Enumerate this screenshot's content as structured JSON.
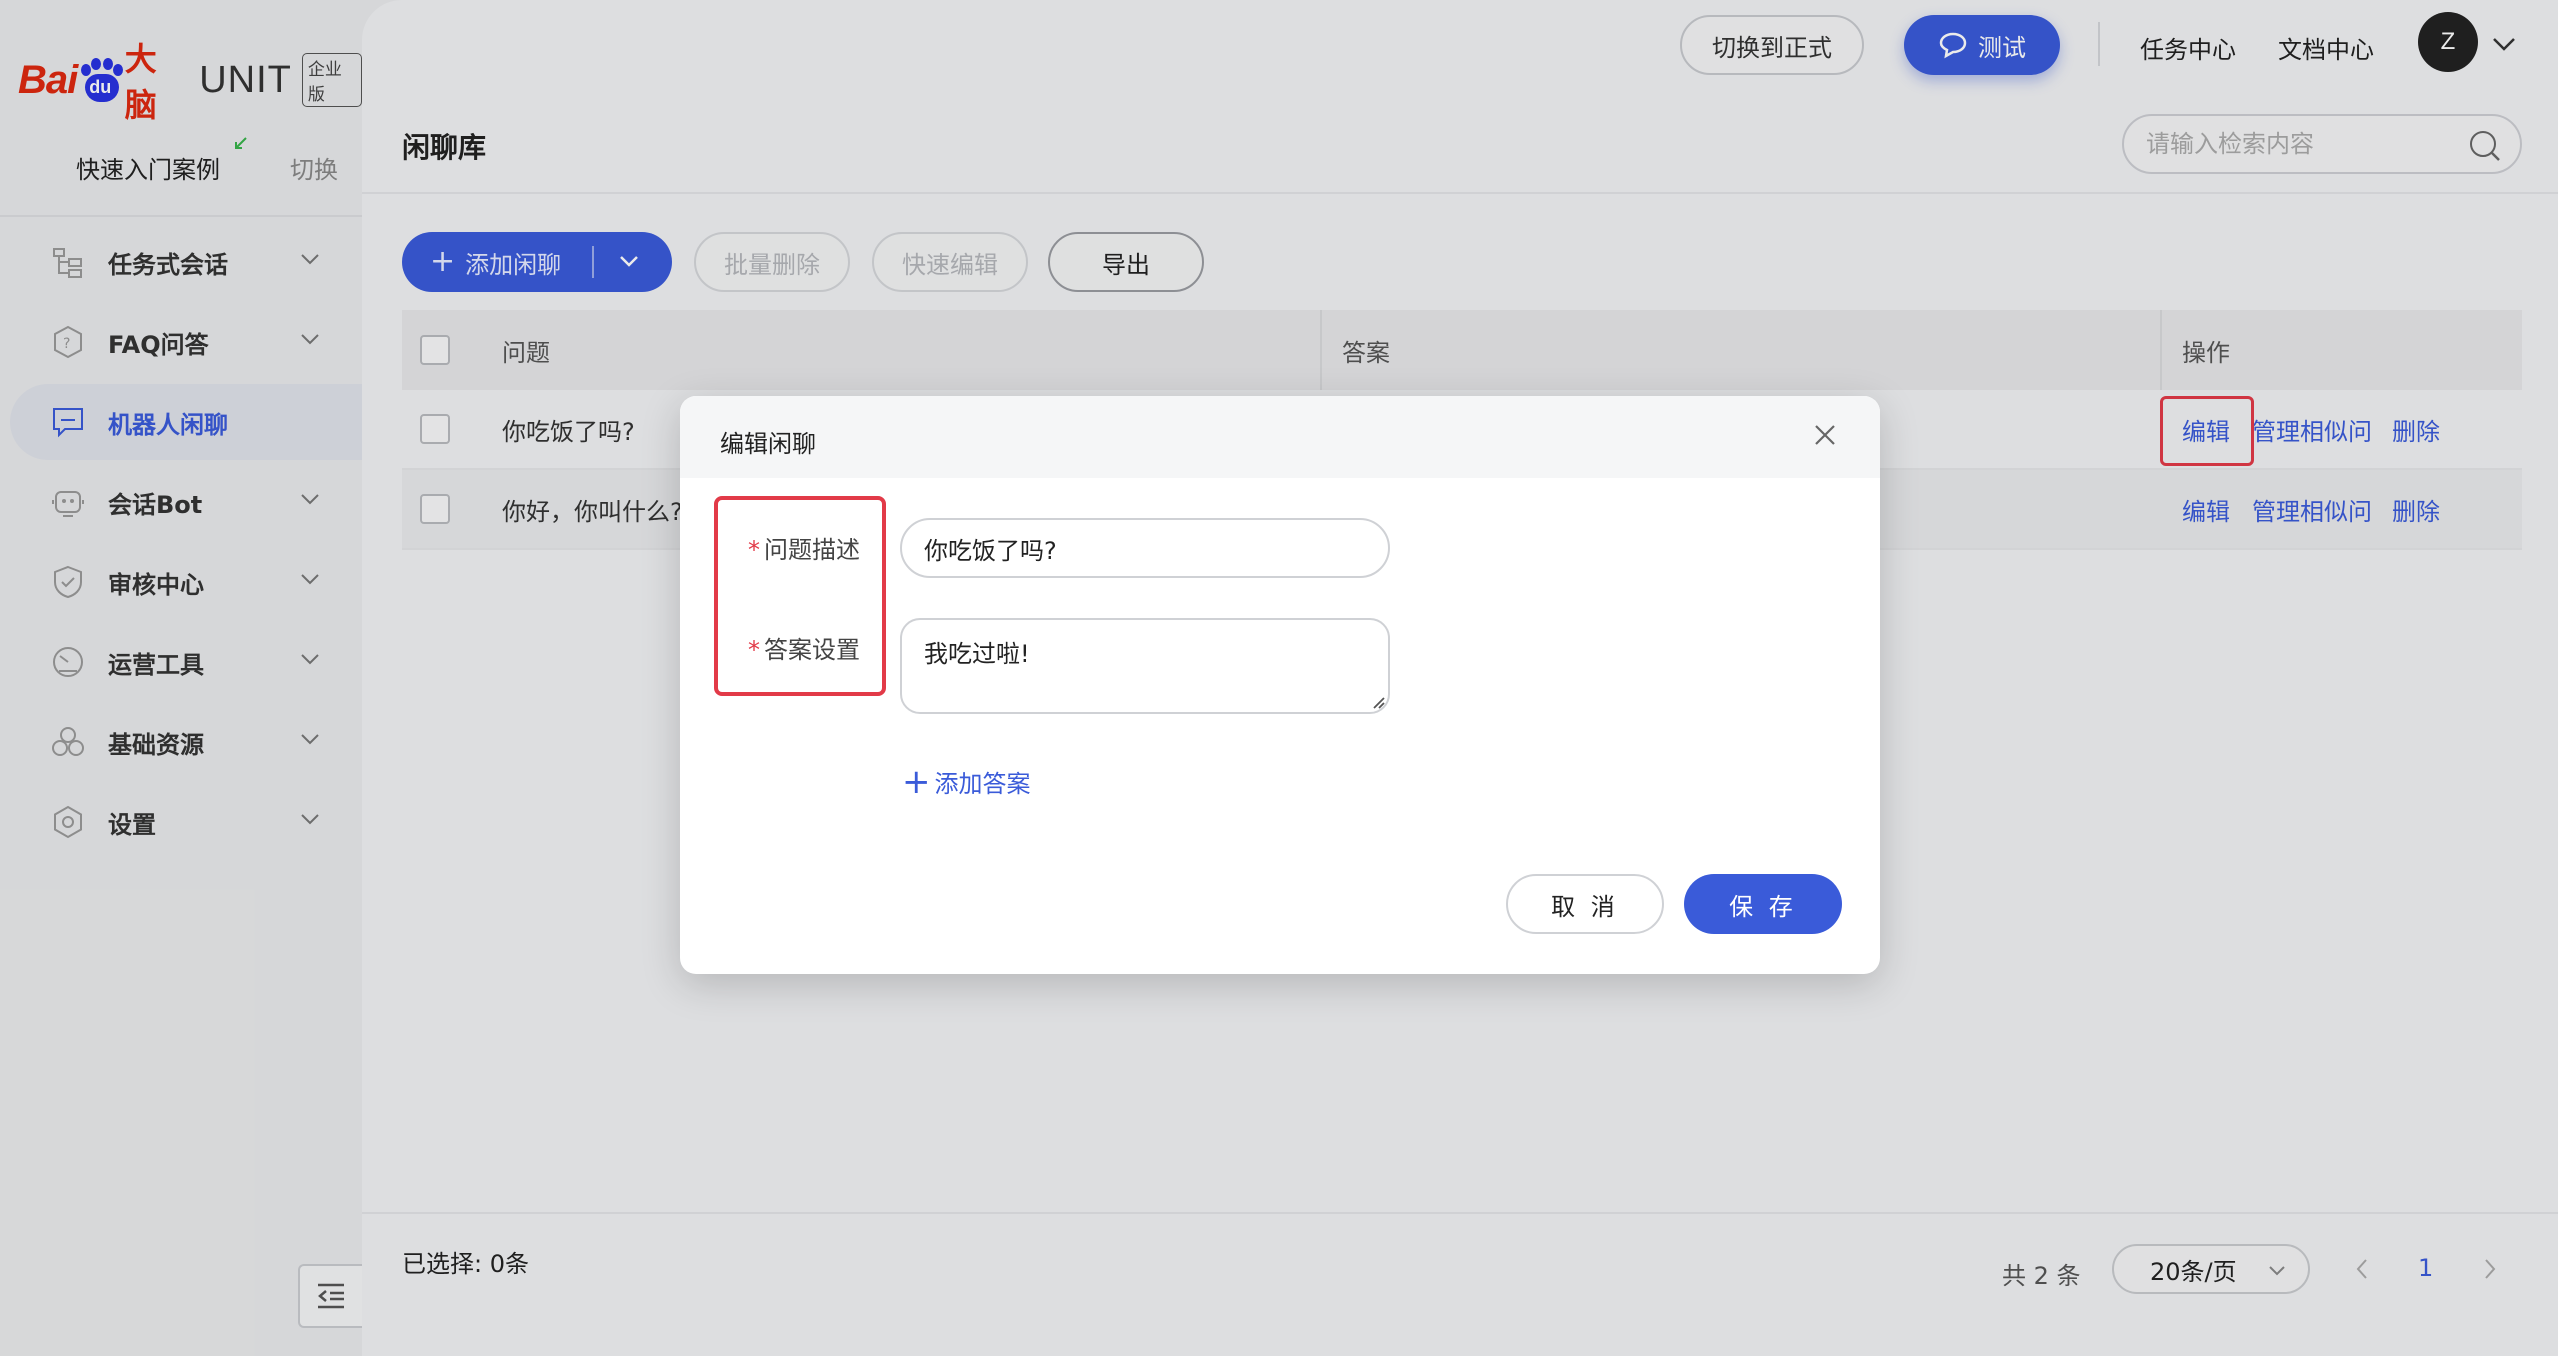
{
  "brand": {
    "logo_text_1": "Bai",
    "logo_text_2": "du",
    "logo_text_3": "大脑",
    "product": "UNIT",
    "edition": "企业版"
  },
  "sidebar": {
    "quick_start": "快速入门案例",
    "switch_label": "切换",
    "items": [
      {
        "label": "任务式会话",
        "icon": "workflow-icon",
        "expandable": true,
        "active": false
      },
      {
        "label": "FAQ问答",
        "icon": "question-shield-icon",
        "expandable": true,
        "active": false
      },
      {
        "label": "机器人闲聊",
        "icon": "chat-bubble-icon",
        "expandable": false,
        "active": true
      },
      {
        "label": "会话Bot",
        "icon": "robot-icon",
        "expandable": true,
        "active": false
      },
      {
        "label": "审核中心",
        "icon": "shield-check-icon",
        "expandable": true,
        "active": false
      },
      {
        "label": "运营工具",
        "icon": "gauge-icon",
        "expandable": true,
        "active": false
      },
      {
        "label": "基础资源",
        "icon": "cubes-icon",
        "expandable": true,
        "active": false
      },
      {
        "label": "设置",
        "icon": "hex-gear-icon",
        "expandable": true,
        "active": false
      }
    ]
  },
  "topbar": {
    "switch_formal": "切换到正式",
    "test": "测试",
    "task_center": "任务中心",
    "doc_center": "文档中心",
    "avatar_initial": "Z"
  },
  "page": {
    "title": "闲聊库",
    "search_placeholder": "请输入检索内容"
  },
  "toolbar": {
    "add": "添加闲聊",
    "batch_delete": "批量删除",
    "quick_edit": "快速编辑",
    "export": "导出"
  },
  "table": {
    "columns": [
      "问题",
      "答案",
      "操作"
    ],
    "rows": [
      {
        "question": "你吃饭了吗?",
        "answer": ""
      },
      {
        "question": "你好，你叫什么?",
        "answer": ""
      }
    ],
    "actions": {
      "edit": "编辑",
      "manage_similar": "管理相似问",
      "delete": "删除"
    }
  },
  "footer": {
    "selected": "已选择: 0条",
    "total": "共 2 条",
    "page_size": "20条/页",
    "current_page": "1"
  },
  "modal": {
    "title": "编辑闲聊",
    "question_label": "问题描述",
    "answer_label": "答案设置",
    "required_mark": "*",
    "question_value": "你吃饭了吗?",
    "answer_value": "我吃过啦!",
    "add_answer": "添加答案",
    "cancel": "取 消",
    "save": "保 存"
  },
  "colors": {
    "primary": "#3a5bd9",
    "highlight": "#e23a48",
    "sidebar_bg": "#e9eaec",
    "brand_red": "#de2910",
    "brand_blue": "#2932e1"
  }
}
